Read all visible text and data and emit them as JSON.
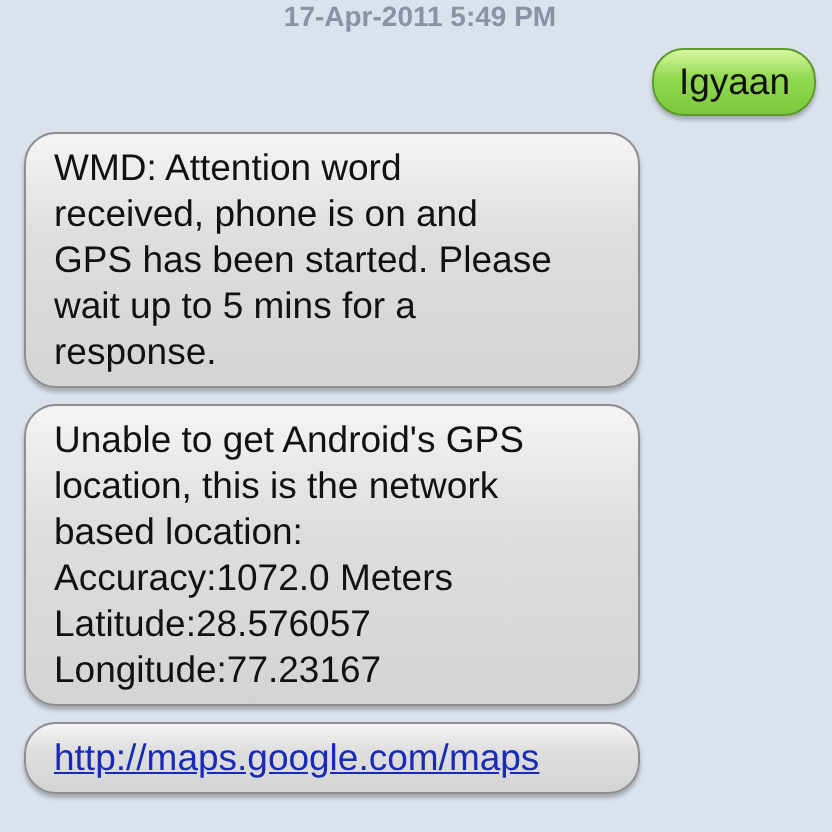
{
  "timestamp": "17-Apr-2011 5:49 PM",
  "messages": [
    {
      "kind": "sent",
      "lines": [
        "Igyaan"
      ]
    },
    {
      "kind": "received",
      "lines": [
        "WMD: Attention word",
        "received, phone is on and",
        "GPS has been started. Please",
        "wait up to 5 mins for a",
        "response."
      ]
    },
    {
      "kind": "received",
      "lines": [
        "Unable to get Android's GPS",
        "location, this is the network",
        "based location:",
        "Accuracy:1072.0 Meters",
        "Latitude:28.576057",
        "Longitude:77.23167"
      ]
    },
    {
      "kind": "link",
      "lines": [
        "http://maps.google.com/maps"
      ]
    }
  ]
}
